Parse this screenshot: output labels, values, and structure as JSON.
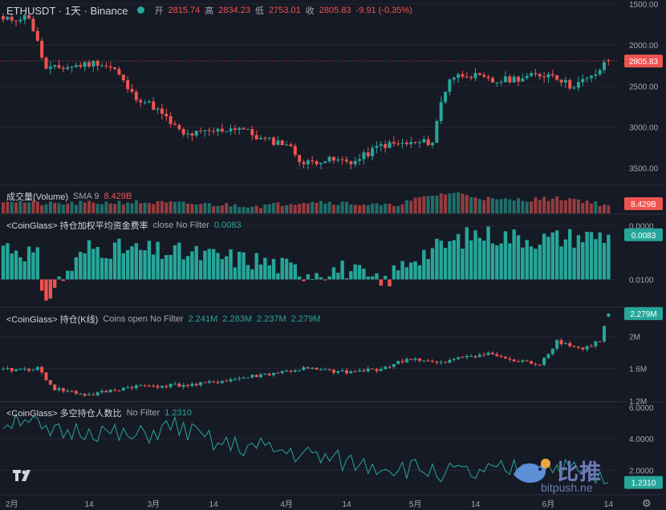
{
  "header": {
    "symbol": "ETHUSDT · 1天 · Binance",
    "open_label": "开",
    "open": "2815.74",
    "high_label": "高",
    "high": "2834.23",
    "low_label": "低",
    "low": "2753.01",
    "close_label": "收",
    "close": "2805.83",
    "change": "-9.91 (-0.35%)"
  },
  "panes": {
    "volume": {
      "title": "成交量(Volume)",
      "ma": "SMA 9",
      "value": "8.429B",
      "badge": "8.429B"
    },
    "funding": {
      "title": "<CoinGlass> 持仓加权平均资金费率",
      "params": "close No Filter",
      "value": "0.0083",
      "badge": "0.0083"
    },
    "oi": {
      "title": "<CoinGlass> 持仓(K线)",
      "params": "Coins open No Filter",
      "v1": "2.241M",
      "v2": "2.283M",
      "v3": "2.237M",
      "v4": "2.279M",
      "badge": "2.279M"
    },
    "ls": {
      "title": "<CoinGlass> 多空持仓人数比",
      "params": "No Filter",
      "value": "1.2310",
      "badge": "1.2310"
    }
  },
  "price_axis": {
    "ticks": [
      "3500.00",
      "3000.00",
      "2500.00",
      "2000.00",
      "1500.00"
    ],
    "badge": "2805.83"
  },
  "funding_axis": {
    "ticks": [
      "0.0100",
      "0.0000"
    ]
  },
  "oi_axis": {
    "ticks": [
      "2M",
      "1.6M",
      "1.2M"
    ]
  },
  "ls_axis": {
    "ticks": [
      "6.0000",
      "4.0000",
      "2.0000"
    ]
  },
  "x_axis": {
    "ticks": [
      "2月",
      "14",
      "3月",
      "14",
      "4月",
      "14",
      "5月",
      "14",
      "6月",
      "14"
    ]
  },
  "watermark": {
    "text": "比推",
    "sub": "bitpush.ne"
  },
  "colors": {
    "bg": "#161a25",
    "up": "#26a69a",
    "down": "#ef5350",
    "grid": "#232632",
    "text": "#a3a6af",
    "line": "#26a69a"
  },
  "chart_data": [
    {
      "type": "candlestick",
      "title": "ETHUSDT · 1天 · Binance",
      "ylim": [
        1300,
        3550
      ],
      "y_ticks": [
        1500,
        2000,
        2500,
        3000,
        3500
      ],
      "x_ticks": [
        "2月",
        "14",
        "3月",
        "14",
        "4月",
        "14",
        "5月",
        "14",
        "6月",
        "14"
      ],
      "anchors": [
        {
          "t": 0,
          "v": 3300
        },
        {
          "t": 6,
          "v": 3350
        },
        {
          "t": 10,
          "v": 2700
        },
        {
          "t": 16,
          "v": 2740
        },
        {
          "t": 22,
          "v": 2790
        },
        {
          "t": 26,
          "v": 2700
        },
        {
          "t": 30,
          "v": 2400
        },
        {
          "t": 35,
          "v": 2250
        },
        {
          "t": 42,
          "v": 1900
        },
        {
          "t": 48,
          "v": 1940
        },
        {
          "t": 55,
          "v": 2000
        },
        {
          "t": 60,
          "v": 1850
        },
        {
          "t": 66,
          "v": 1800
        },
        {
          "t": 70,
          "v": 1550
        },
        {
          "t": 74,
          "v": 1600
        },
        {
          "t": 82,
          "v": 1580
        },
        {
          "t": 88,
          "v": 1780
        },
        {
          "t": 95,
          "v": 1800
        },
        {
          "t": 100,
          "v": 1820
        },
        {
          "t": 102,
          "v": 2300
        },
        {
          "t": 104,
          "v": 2600
        },
        {
          "t": 108,
          "v": 2650
        },
        {
          "t": 114,
          "v": 2550
        },
        {
          "t": 120,
          "v": 2600
        },
        {
          "t": 128,
          "v": 2650
        },
        {
          "t": 132,
          "v": 2500
        },
        {
          "t": 137,
          "v": 2600
        },
        {
          "t": 141,
          "v": 2806
        }
      ],
      "last": {
        "open": 2815.74,
        "high": 2834.23,
        "low": 2753.01,
        "close": 2805.83
      }
    },
    {
      "type": "bar",
      "title": "成交量(Volume)",
      "unit": "B",
      "anchors": [
        {
          "t": 0,
          "v": 14
        },
        {
          "t": 10,
          "v": 10
        },
        {
          "t": 30,
          "v": 12
        },
        {
          "t": 60,
          "v": 8
        },
        {
          "t": 72,
          "v": 13
        },
        {
          "t": 90,
          "v": 8
        },
        {
          "t": 101,
          "v": 20
        },
        {
          "t": 105,
          "v": 22
        },
        {
          "t": 115,
          "v": 14
        },
        {
          "t": 132,
          "v": 16
        },
        {
          "t": 141,
          "v": 8.429
        }
      ],
      "last": 8.429
    },
    {
      "type": "bar",
      "title": "<CoinGlass> 持仓加权平均资金费率",
      "ylim": [
        -0.005,
        0.012
      ],
      "y_ticks": [
        0.0,
        0.01
      ],
      "anchors": [
        {
          "t": 0,
          "v": 0.0065
        },
        {
          "t": 8,
          "v": 0.0045
        },
        {
          "t": 9,
          "v": -0.004
        },
        {
          "t": 20,
          "v": 0.006
        },
        {
          "t": 40,
          "v": 0.005
        },
        {
          "t": 60,
          "v": 0.0035
        },
        {
          "t": 70,
          "v": 0.0015
        },
        {
          "t": 80,
          "v": 0.002
        },
        {
          "t": 88,
          "v": -0.001
        },
        {
          "t": 95,
          "v": 0.004
        },
        {
          "t": 110,
          "v": 0.0085
        },
        {
          "t": 125,
          "v": 0.0075
        },
        {
          "t": 141,
          "v": 0.0083
        }
      ],
      "last": 0.0083
    },
    {
      "type": "candlestick",
      "title": "<CoinGlass> 持仓(K线)",
      "unit": "M",
      "ylim": [
        1.2,
        2.35
      ],
      "y_ticks": [
        1.2,
        1.6,
        2.0
      ],
      "anchors": [
        {
          "t": 0,
          "v": 1.58
        },
        {
          "t": 8,
          "v": 1.6
        },
        {
          "t": 12,
          "v": 1.35
        },
        {
          "t": 20,
          "v": 1.27
        },
        {
          "t": 30,
          "v": 1.38
        },
        {
          "t": 45,
          "v": 1.4
        },
        {
          "t": 55,
          "v": 1.48
        },
        {
          "t": 70,
          "v": 1.6
        },
        {
          "t": 80,
          "v": 1.55
        },
        {
          "t": 88,
          "v": 1.6
        },
        {
          "t": 95,
          "v": 1.73
        },
        {
          "t": 102,
          "v": 1.66
        },
        {
          "t": 108,
          "v": 1.76
        },
        {
          "t": 114,
          "v": 1.78
        },
        {
          "t": 118,
          "v": 1.7
        },
        {
          "t": 125,
          "v": 1.66
        },
        {
          "t": 129,
          "v": 1.94
        },
        {
          "t": 135,
          "v": 1.84
        },
        {
          "t": 139,
          "v": 1.95
        },
        {
          "t": 141,
          "v": 2.279
        }
      ],
      "last": {
        "open": 2.241,
        "high": 2.283,
        "low": 2.237,
        "close": 2.279
      }
    },
    {
      "type": "line",
      "title": "<CoinGlass> 多空持仓人数比",
      "ylim": [
        0.5,
        6.3
      ],
      "y_ticks": [
        2.0,
        4.0,
        6.0
      ],
      "anchors": [
        {
          "t": 0,
          "v": 5.0
        },
        {
          "t": 5,
          "v": 5.5
        },
        {
          "t": 10,
          "v": 4.2
        },
        {
          "t": 20,
          "v": 4.6
        },
        {
          "t": 30,
          "v": 4.0
        },
        {
          "t": 40,
          "v": 4.8
        },
        {
          "t": 50,
          "v": 3.6
        },
        {
          "t": 60,
          "v": 3.4
        },
        {
          "t": 70,
          "v": 3.0
        },
        {
          "t": 80,
          "v": 2.5
        },
        {
          "t": 90,
          "v": 2.2
        },
        {
          "t": 100,
          "v": 2.0
        },
        {
          "t": 110,
          "v": 1.7
        },
        {
          "t": 120,
          "v": 2.1
        },
        {
          "t": 130,
          "v": 2.2
        },
        {
          "t": 141,
          "v": 1.231
        }
      ],
      "last": 1.231
    }
  ]
}
